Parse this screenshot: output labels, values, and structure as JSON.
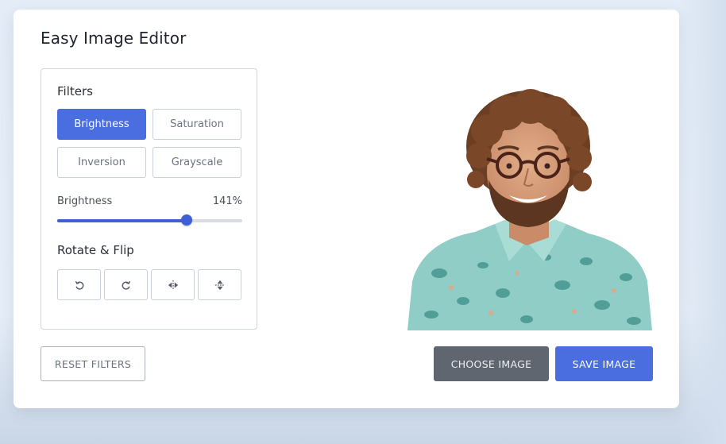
{
  "app": {
    "title": "Easy Image Editor"
  },
  "filters": {
    "heading": "Filters",
    "options": [
      {
        "label": "Brightness",
        "active": true
      },
      {
        "label": "Saturation",
        "active": false
      },
      {
        "label": "Inversion",
        "active": false
      },
      {
        "label": "Grayscale",
        "active": false
      }
    ],
    "slider": {
      "name": "Brightness",
      "value_text": "141%",
      "fraction": 0.7
    }
  },
  "rotate_flip": {
    "heading": "Rotate & Flip",
    "buttons": [
      {
        "icon": "rotate-left-icon"
      },
      {
        "icon": "rotate-right-icon"
      },
      {
        "icon": "flip-horizontal-icon"
      },
      {
        "icon": "flip-vertical-icon"
      }
    ]
  },
  "actions": {
    "reset_label": "RESET FILTERS",
    "choose_label": "CHOOSE IMAGE",
    "save_label": "SAVE IMAGE"
  },
  "colors": {
    "accent": "#4a6ee0",
    "dark_button": "#5f6670"
  }
}
